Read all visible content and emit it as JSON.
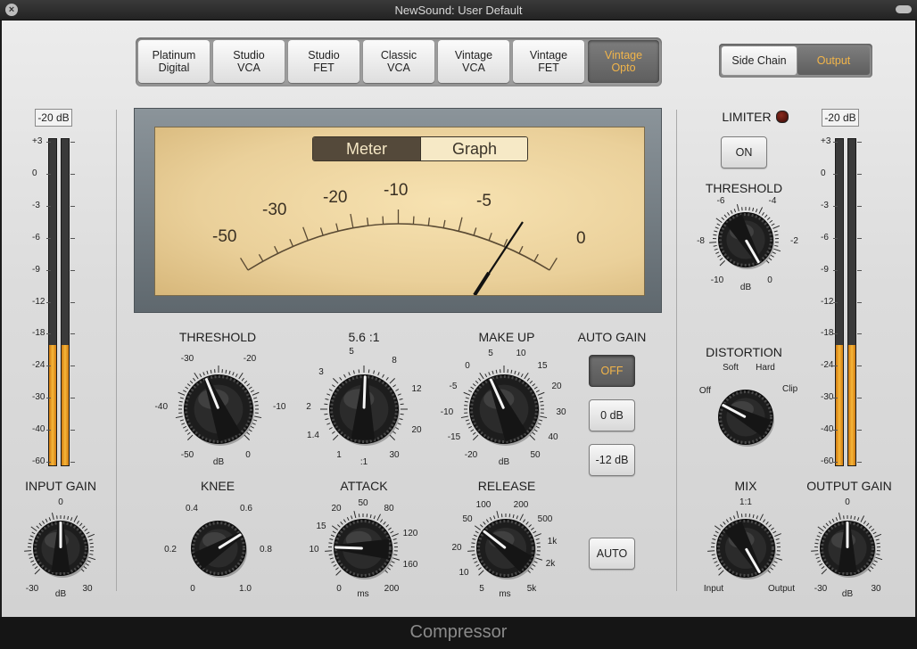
{
  "window": {
    "title": "NewSound: User Default",
    "footer_title": "Compressor"
  },
  "models": [
    {
      "label": "Platinum\nDigital",
      "active": false
    },
    {
      "label": "Studio\nVCA",
      "active": false
    },
    {
      "label": "Studio\nFET",
      "active": false
    },
    {
      "label": "Classic\nVCA",
      "active": false
    },
    {
      "label": "Vintage\nVCA",
      "active": false
    },
    {
      "label": "Vintage\nFET",
      "active": false
    },
    {
      "label": "Vintage\nOpto",
      "active": true
    }
  ],
  "side_chain_label": "Side Chain",
  "output_label": "Output",
  "input_meter": {
    "value": "-20 dB",
    "level": 0.37
  },
  "output_meter": {
    "value": "-20 dB",
    "level": 0.37
  },
  "meter_scale": [
    "+3",
    "0",
    "-3",
    "-6",
    "-9",
    "-12",
    "-18",
    "-24",
    "-30",
    "-40",
    "-60"
  ],
  "vu": {
    "tab_meter": "Meter",
    "tab_graph": "Graph",
    "active_tab": "Meter",
    "scale_labels": [
      "-50",
      "-30",
      "-20",
      "-10",
      "-5",
      "0"
    ]
  },
  "controls": {
    "threshold": {
      "label": "THRESHOLD",
      "ticks": [
        "-30",
        "-20",
        "-40",
        "-10",
        "-50",
        "dB",
        "0"
      ]
    },
    "ratio": {
      "label": "5.6 :1",
      "ticks": [
        "5",
        "8",
        "3",
        "12",
        "2",
        "20",
        "1.4",
        "30",
        "1",
        ":1"
      ]
    },
    "makeup": {
      "label": "MAKE UP",
      "ticks": [
        "5",
        "10",
        "0",
        "15",
        "-5",
        "20",
        "-10",
        "30",
        "-15",
        "40",
        "-20",
        "dB",
        "50"
      ]
    },
    "knee": {
      "label": "KNEE",
      "ticks": [
        "0.4",
        "0.6",
        "0.2",
        "0.8",
        "0",
        "1.0"
      ]
    },
    "attack": {
      "label": "ATTACK",
      "ticks": [
        "50",
        "20",
        "80",
        "15",
        "120",
        "10",
        "160",
        "0",
        "ms",
        "200"
      ]
    },
    "release": {
      "label": "RELEASE",
      "ticks": [
        "100",
        "200",
        "50",
        "500",
        "20",
        "1k",
        "10",
        "2k",
        "5",
        "ms",
        "5k"
      ]
    },
    "input_gain": {
      "label": "INPUT GAIN",
      "ticks": [
        "0",
        "-30",
        "dB",
        "30"
      ]
    },
    "output_gain": {
      "label": "OUTPUT GAIN",
      "ticks": [
        "0",
        "-30",
        "dB",
        "30"
      ]
    },
    "mix": {
      "label": "MIX",
      "ticks": [
        "1:1",
        "Input",
        "Output"
      ]
    },
    "limiter_threshold": {
      "label": "THRESHOLD",
      "ticks": [
        "-6",
        "-4",
        "-8",
        "-2",
        "-10",
        "dB",
        "0"
      ]
    },
    "distortion": {
      "label": "DISTORTION",
      "ticks": [
        "Soft",
        "Hard",
        "Off",
        "Clip"
      ]
    }
  },
  "auto_gain": {
    "label": "AUTO GAIN",
    "buttons": [
      {
        "label": "OFF",
        "active": true
      },
      {
        "label": "0 dB",
        "active": false
      },
      {
        "label": "-12 dB",
        "active": false
      }
    ]
  },
  "auto_label": "AUTO",
  "limiter": {
    "label": "LIMITER",
    "button": "ON"
  },
  "colors": {
    "accent": "#f2b54a",
    "meter_orange": "#f0a020",
    "panel": "#e0e0e0",
    "vu_face": "#f0d8a6"
  }
}
